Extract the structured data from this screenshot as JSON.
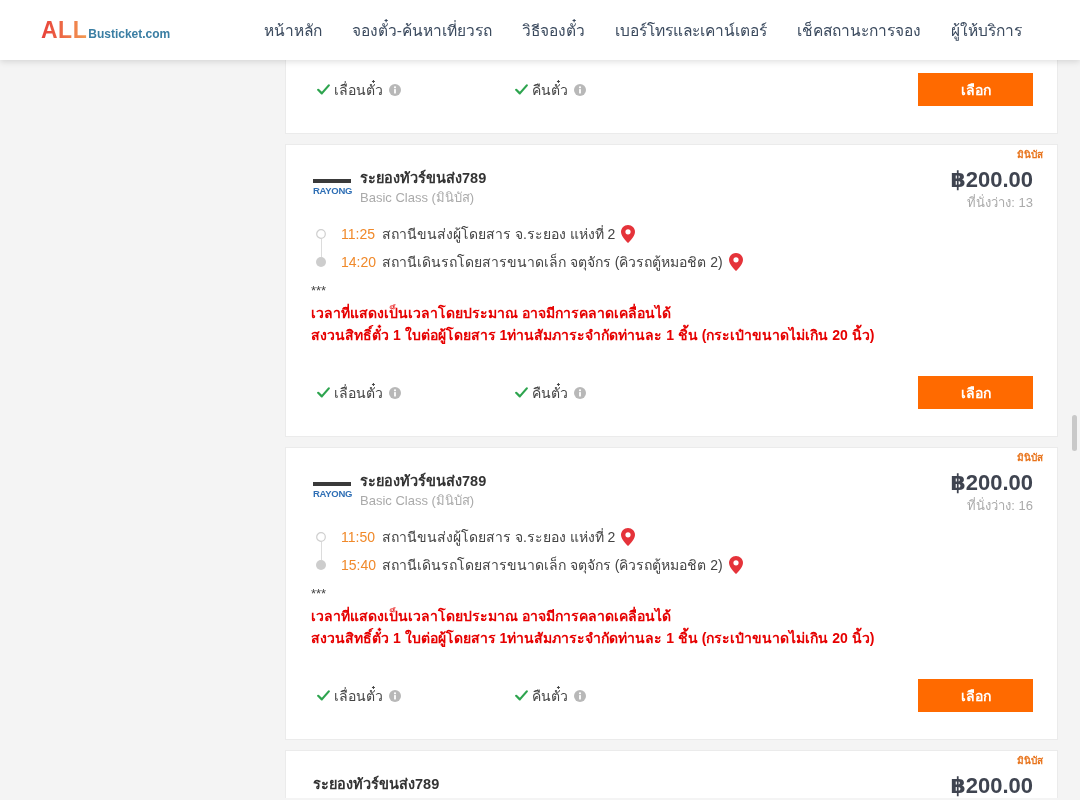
{
  "header": {
    "logo": {
      "brand": "ALL",
      "domain": "Busticket.com"
    },
    "nav": [
      {
        "label": "หน้าหลัก"
      },
      {
        "label": "จองตั๋ว-ค้นหาเที่ยวรถ"
      },
      {
        "label": "วิธีจองตั๋ว"
      },
      {
        "label": "เบอร์โทรและเคาน์เตอร์"
      },
      {
        "label": "เช็คสถานะการจอง"
      },
      {
        "label": "ผู้ให้บริการ"
      }
    ]
  },
  "trips": [
    {
      "policies": [
        {
          "label": "เลื่อนตั๋ว",
          "allowed": true
        },
        {
          "label": "คืนตั๋ว",
          "allowed": true
        }
      ],
      "button": "เลือก"
    },
    {
      "tag": "มินิบัส",
      "logo": "RAYONG",
      "operator": "ระยองทัวร์ขนส่ง789",
      "bus_class": "Basic Class (มินิบัส)",
      "price": "฿200.00",
      "seats": "ที่นั่งว่าง: 13",
      "stops": [
        {
          "kind": "departure",
          "time": "11:25",
          "station": "สถานีขนส่งผู้โดยสาร จ.ระยอง แห่งที่ 2"
        },
        {
          "kind": "arrival",
          "time": "14:20",
          "station": "สถานีเดินรถโดยสารขนาดเล็ก จตุจักร (คิวรถตู้หมอชิต 2)"
        }
      ],
      "note": {
        "marker": "***",
        "lines": [
          "เวลาที่แสดงเป็นเวลาโดยประมาณ อาจมีการคลาดเคลื่อนได้",
          "สงวนสิทธิ์ตั๋ว 1 ใบต่อผู้โดยสาร 1ท่านสัมภาระจำกัดท่านละ 1 ชิ้น (กระเป๋าขนาดไม่เกิน 20 นิ้ว)"
        ]
      },
      "policies": [
        {
          "label": "เลื่อนตั๋ว",
          "allowed": true
        },
        {
          "label": "คืนตั๋ว",
          "allowed": true
        }
      ],
      "button": "เลือก"
    },
    {
      "tag": "มินิบัส",
      "logo": "RAYONG",
      "operator": "ระยองทัวร์ขนส่ง789",
      "bus_class": "Basic Class (มินิบัส)",
      "price": "฿200.00",
      "seats": "ที่นั่งว่าง: 16",
      "stops": [
        {
          "kind": "departure",
          "time": "11:50",
          "station": "สถานีขนส่งผู้โดยสาร จ.ระยอง แห่งที่ 2"
        },
        {
          "kind": "arrival",
          "time": "15:40",
          "station": "สถานีเดินรถโดยสารขนาดเล็ก จตุจักร (คิวรถตู้หมอชิต 2)"
        }
      ],
      "note": {
        "marker": "***",
        "lines": [
          "เวลาที่แสดงเป็นเวลาโดยประมาณ อาจมีการคลาดเคลื่อนได้",
          "สงวนสิทธิ์ตั๋ว 1 ใบต่อผู้โดยสาร 1ท่านสัมภาระจำกัดท่านละ 1 ชิ้น (กระเป๋าขนาดไม่เกิน 20 นิ้ว)"
        ]
      },
      "policies": [
        {
          "label": "เลื่อนตั๋ว",
          "allowed": true
        },
        {
          "label": "คืนตั๋ว",
          "allowed": true
        }
      ],
      "button": "เลือก"
    },
    {
      "tag": "มินิบัส",
      "operator": "ระยองทัวร์ขนส่ง789",
      "price": "฿200.00"
    }
  ]
}
